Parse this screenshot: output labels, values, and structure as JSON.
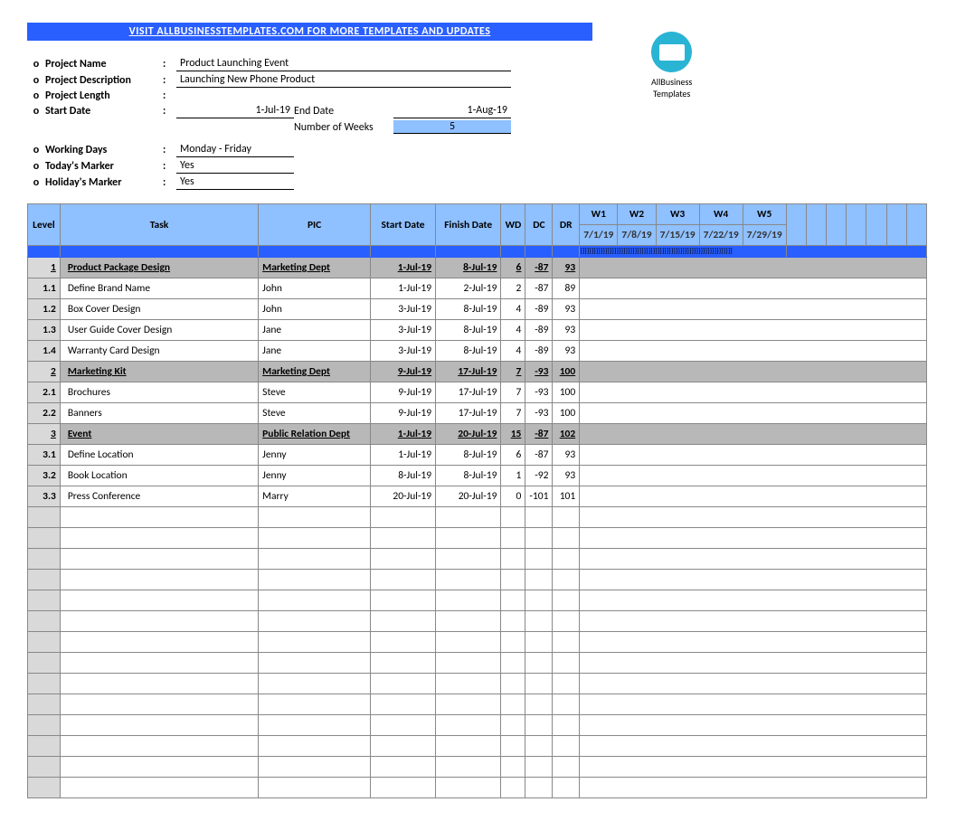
{
  "banner": "VISIT ALLBUSINESSTEMPLATES.COM FOR MORE TEMPLATES AND UPDATES",
  "logo_text": "AllBusiness\nTemplates",
  "meta": {
    "project_name_label": "Project Name",
    "project_name": "Product Launching Event",
    "project_desc_label": "Project Description",
    "project_desc": "Launching New Phone Product",
    "project_length_label": "Project Length",
    "project_length": "",
    "start_date_label": "Start Date",
    "start_date": "1-Jul-19",
    "end_date_label": "End Date",
    "end_date": "1-Aug-19",
    "num_weeks_label": "Number of Weeks",
    "num_weeks": "5",
    "working_days_label": "Working Days",
    "working_days": "Monday - Friday",
    "todays_marker_label": "Today's Marker",
    "todays_marker": "Yes",
    "holidays_marker_label": "Holiday's Marker",
    "holidays_marker": "Yes"
  },
  "headers": {
    "level": "Level",
    "task": "Task",
    "pic": "PIC",
    "start": "Start Date",
    "finish": "Finish Date",
    "wd": "WD",
    "dc": "DC",
    "dr": "DR"
  },
  "weeks": [
    {
      "w": "W1",
      "d": "7/1/19"
    },
    {
      "w": "W2",
      "d": "7/8/19"
    },
    {
      "w": "W3",
      "d": "7/15/19"
    },
    {
      "w": "W4",
      "d": "7/22/19"
    },
    {
      "w": "W5",
      "d": "7/29/19"
    }
  ],
  "gantt_tick": "}}}}}}}}}}}}}}}}}}}}}}}}}}}}}}}}}}}}}}}}}}}}}}}}}}}}}}}}}}}}}}}}}}}",
  "rows": [
    {
      "type": "group",
      "level": "1",
      "task": "Product Package Design",
      "pic": "Marketing Dept",
      "sd": "1-Jul-19",
      "fd": "8-Jul-19",
      "wd": "6",
      "dc": "-87",
      "dr": "93"
    },
    {
      "type": "row",
      "level": "1.1",
      "task": "Define Brand Name",
      "pic": "John",
      "sd": "1-Jul-19",
      "fd": "2-Jul-19",
      "wd": "2",
      "dc": "-87",
      "dr": "89"
    },
    {
      "type": "row",
      "level": "1.2",
      "task": "Box Cover Design",
      "pic": "John",
      "sd": "3-Jul-19",
      "fd": "8-Jul-19",
      "wd": "4",
      "dc": "-89",
      "dr": "93"
    },
    {
      "type": "row",
      "level": "1.3",
      "task": "User Guide Cover Design",
      "pic": "Jane",
      "sd": "3-Jul-19",
      "fd": "8-Jul-19",
      "wd": "4",
      "dc": "-89",
      "dr": "93"
    },
    {
      "type": "row",
      "level": "1.4",
      "task": "Warranty Card Design",
      "pic": "Jane",
      "sd": "3-Jul-19",
      "fd": "8-Jul-19",
      "wd": "4",
      "dc": "-89",
      "dr": "93"
    },
    {
      "type": "group",
      "level": "2",
      "task": "Marketing Kit",
      "pic": "Marketing Dept",
      "sd": "9-Jul-19",
      "fd": "17-Jul-19",
      "wd": "7",
      "dc": "-93",
      "dr": "100"
    },
    {
      "type": "row",
      "level": "2.1",
      "task": "Brochures",
      "pic": "Steve",
      "sd": "9-Jul-19",
      "fd": "17-Jul-19",
      "wd": "7",
      "dc": "-93",
      "dr": "100"
    },
    {
      "type": "row",
      "level": "2.2",
      "task": "Banners",
      "pic": "Steve",
      "sd": "9-Jul-19",
      "fd": "17-Jul-19",
      "wd": "7",
      "dc": "-93",
      "dr": "100"
    },
    {
      "type": "group",
      "level": "3",
      "task": "Event",
      "pic": "Public Relation Dept",
      "sd": "1-Jul-19",
      "fd": "20-Jul-19",
      "wd": "15",
      "dc": "-87",
      "dr": "102"
    },
    {
      "type": "row",
      "level": "3.1",
      "task": "Define Location",
      "pic": "Jenny",
      "sd": "1-Jul-19",
      "fd": "8-Jul-19",
      "wd": "6",
      "dc": "-87",
      "dr": "93"
    },
    {
      "type": "row",
      "level": "3.2",
      "task": "Book Location",
      "pic": "Jenny",
      "sd": "8-Jul-19",
      "fd": "8-Jul-19",
      "wd": "1",
      "dc": "-92",
      "dr": "93"
    },
    {
      "type": "row",
      "level": "3.3",
      "task": "Press Conference",
      "pic": "Marry",
      "sd": "20-Jul-19",
      "fd": "20-Jul-19",
      "wd": "0",
      "dc": "-101",
      "dr": "101"
    }
  ],
  "empty_rows": 14
}
